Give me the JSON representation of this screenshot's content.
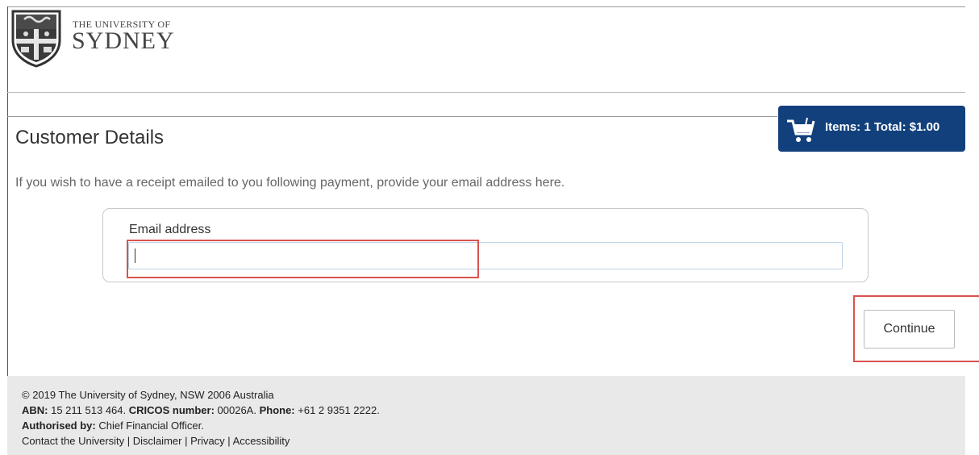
{
  "header": {
    "brand_small": "THE UNIVERSITY OF",
    "brand_big": "SYDNEY",
    "logo_icon": "university-crest-icon"
  },
  "cart": {
    "icon": "shopping-cart-icon",
    "label": "Items: 1 Total: $1.00",
    "bg_color": "#12407c"
  },
  "page": {
    "title": "Customer Details",
    "intro": "If you wish to have a receipt emailed to you following payment, provide your email address here."
  },
  "form": {
    "email_label": "Email address",
    "email_value": "",
    "email_placeholder": ""
  },
  "actions": {
    "continue_label": "Continue"
  },
  "highlights": {
    "color": "#d9534f"
  },
  "footer": {
    "copyright": "© 2019 The University of Sydney, NSW 2006 Australia",
    "abn_label": "ABN:",
    "abn_value": " 15 211 513 464. ",
    "cricos_label": "CRICOS number:",
    "cricos_value": " 00026A. ",
    "phone_label": "Phone:",
    "phone_value": " +61 2 9351 2222.",
    "authorised_label": "Authorised by:",
    "authorised_value": " Chief Financial Officer.",
    "links": [
      "Contact the University",
      "Disclaimer",
      "Privacy",
      "Accessibility"
    ],
    "link_separator": " | "
  }
}
